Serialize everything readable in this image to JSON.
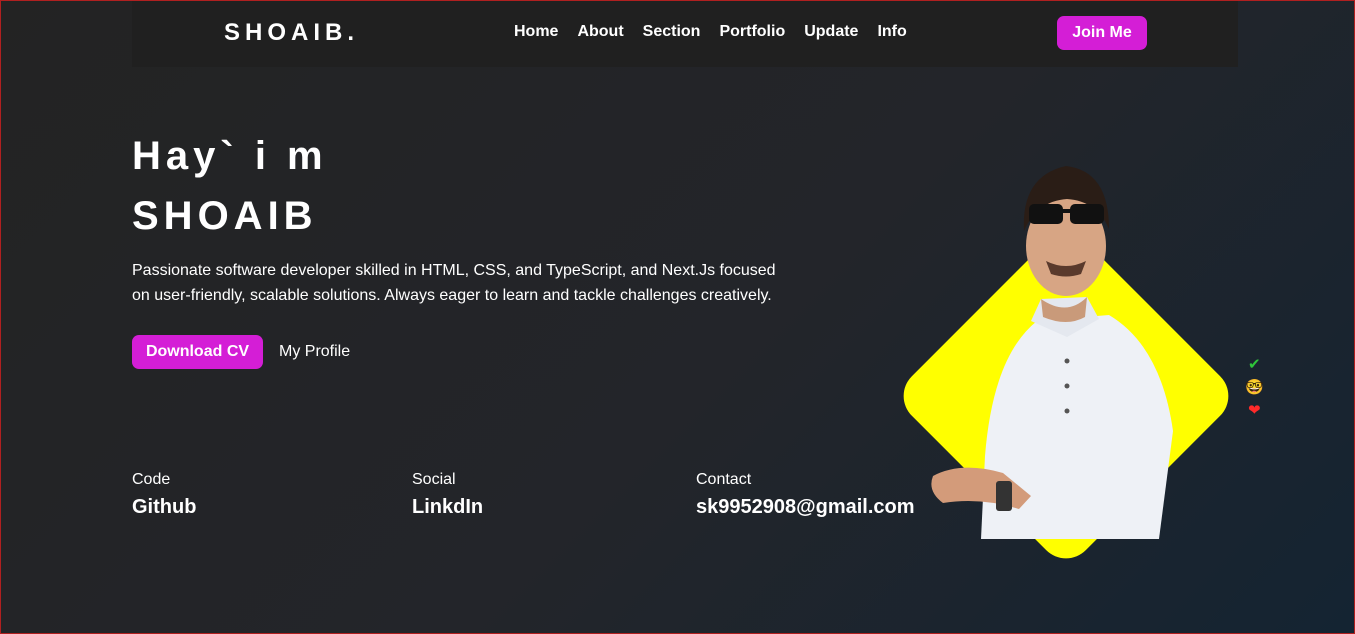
{
  "navbar": {
    "logo": "SHOAIB.",
    "links": [
      "Home",
      "About",
      "Section",
      "Portfolio",
      "Update",
      "Info"
    ],
    "cta_label": "Join Me"
  },
  "hero": {
    "line1": "Hay` i m",
    "line2": "SHOAIB",
    "bio": "Passionate software developer skilled in HTML, CSS, and TypeScript, and Next.Js focused on user-friendly, scalable solutions. Always eager to learn and tackle challenges creatively.",
    "download_label": "Download CV",
    "profile_label": "My Profile"
  },
  "stats": [
    {
      "label": "Code",
      "value": "Github"
    },
    {
      "label": "Social",
      "value": "LinkdIn"
    },
    {
      "label": "Contact",
      "value": "sk9952908@gmail.com"
    }
  ],
  "emojis": [
    "✔",
    "🤓",
    "❤"
  ],
  "colors": {
    "accent": "#d41ed6",
    "diamond": "#ffff00",
    "background": "#232323"
  }
}
